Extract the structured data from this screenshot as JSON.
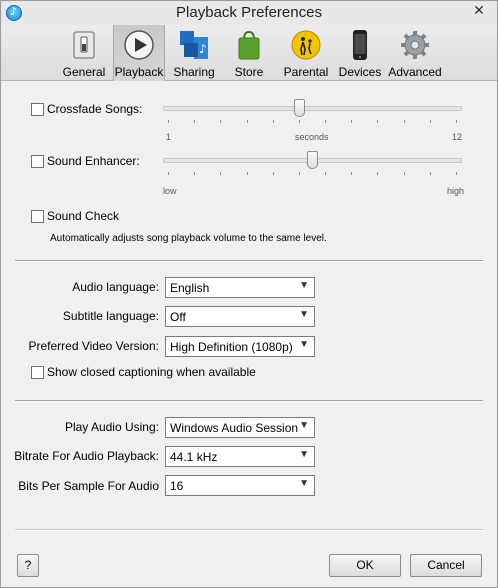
{
  "window": {
    "title": "Playback Preferences",
    "close_glyph": "✕"
  },
  "toolbar": {
    "tabs": [
      {
        "label": "General",
        "icon": "switch-icon"
      },
      {
        "label": "Playback",
        "icon": "play-icon"
      },
      {
        "label": "Sharing",
        "icon": "sharing-icon"
      },
      {
        "label": "Store",
        "icon": "store-bag-icon"
      },
      {
        "label": "Parental",
        "icon": "parental-icon"
      },
      {
        "label": "Devices",
        "icon": "phone-icon"
      },
      {
        "label": "Advanced",
        "icon": "gear-icon"
      }
    ],
    "active": "Playback"
  },
  "playback": {
    "crossfade": {
      "label": "Crossfade Songs:",
      "checked": false,
      "min_label": "1",
      "mid_label": "seconds",
      "max_label": "12",
      "value": 6,
      "min": 1,
      "max": 12
    },
    "sound_enhancer": {
      "label": "Sound Enhancer:",
      "checked": false,
      "min_label": "low",
      "max_label": "high",
      "value_fraction": 0.5
    },
    "sound_check": {
      "label": "Sound Check",
      "checked": false,
      "description": "Automatically adjusts song playback volume to the same level."
    }
  },
  "language": {
    "audio_language": {
      "label": "Audio language:",
      "value": "English"
    },
    "subtitle_language": {
      "label": "Subtitle language:",
      "value": "Off"
    },
    "preferred_video": {
      "label": "Preferred Video Version:",
      "value": "High Definition (1080p)"
    },
    "closed_captioning": {
      "label": "Show closed captioning when available",
      "checked": false
    }
  },
  "audio": {
    "play_audio_using": {
      "label": "Play Audio Using:",
      "value": "Windows Audio Session"
    },
    "bitrate": {
      "label": "Bitrate For Audio Playback:",
      "value": "44.1 kHz"
    },
    "bits_per_sample": {
      "label": "Bits Per Sample For Audio",
      "value": "16"
    }
  },
  "footer": {
    "help_label": "?",
    "ok_label": "OK",
    "cancel_label": "Cancel"
  },
  "colors": {
    "window_bg": "#f0f0f0",
    "parental_yellow": "#f5c400",
    "store_green": "#5aa02c",
    "sharing_blue": "#1f6fbf"
  }
}
